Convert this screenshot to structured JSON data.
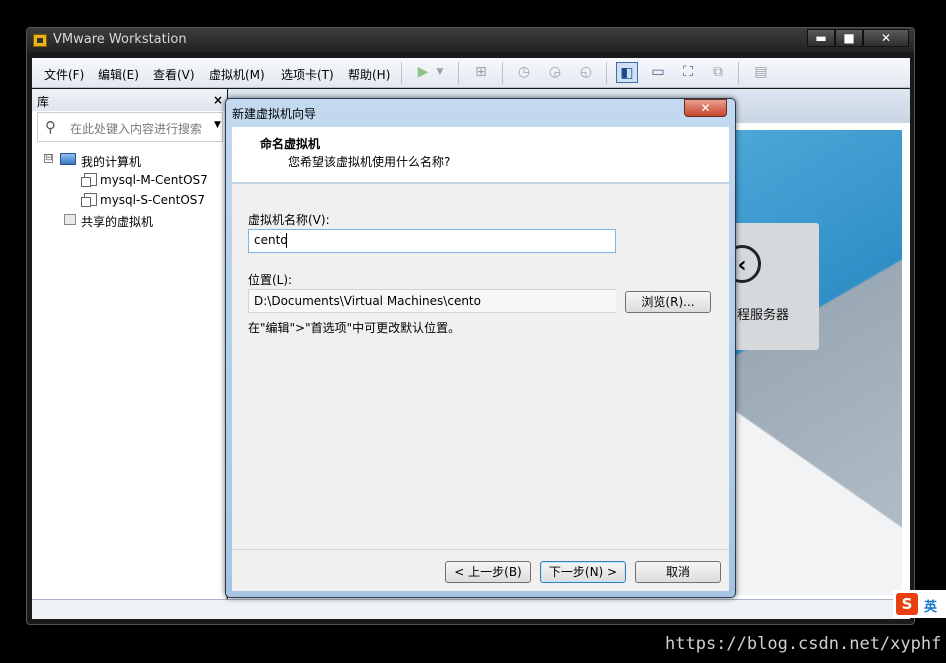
{
  "window": {
    "title": "VMware Workstation",
    "controls": {
      "minimize": "▬",
      "maximize": "■",
      "close": "✕"
    }
  },
  "menu": [
    {
      "label": "文件(F)"
    },
    {
      "label": "编辑(E)"
    },
    {
      "label": "查看(V)"
    },
    {
      "label": "虚拟机(M)"
    },
    {
      "label": "选项卡(T)"
    },
    {
      "label": "帮助(H)"
    }
  ],
  "toolbar_icons": [
    "play-icon",
    "dropdown-icon",
    "network-icon",
    "snapshot-icon",
    "revert-snapshot-icon",
    "manage-snapshot-icon",
    "library-view-icon",
    "console-view-icon",
    "fullscreen-icon",
    "unity-icon",
    "tabs-icon"
  ],
  "library": {
    "title": "库",
    "close": "×",
    "search_placeholder": "在此处键入内容进行搜索",
    "tree": {
      "root": "我的计算机",
      "expander": "⊟",
      "vms": [
        "mysql-M-CentOS7",
        "mysql-S-CentOS7"
      ],
      "shared": "共享的虚拟机"
    }
  },
  "home": {
    "remote_label": "程服务器"
  },
  "dialog": {
    "title": "新建虚拟机向导",
    "close": "✕",
    "header_title": "命名虚拟机",
    "header_subtitle": "您希望该虚拟机使用什么名称?",
    "name_label": "虚拟机名称(V):",
    "name_value": "cento",
    "location_label": "位置(L):",
    "location_value": "D:\\Documents\\Virtual Machines\\cento",
    "browse_label": "浏览(R)...",
    "hint": "在\"编辑\">\"首选项\"中可更改默认位置。",
    "back_label": "< 上一步(B)",
    "next_label": "下一步(N) >",
    "cancel_label": "取消"
  },
  "ime": {
    "logo": "S",
    "lang": "英"
  },
  "watermark": "https://blog.csdn.net/xyphf"
}
